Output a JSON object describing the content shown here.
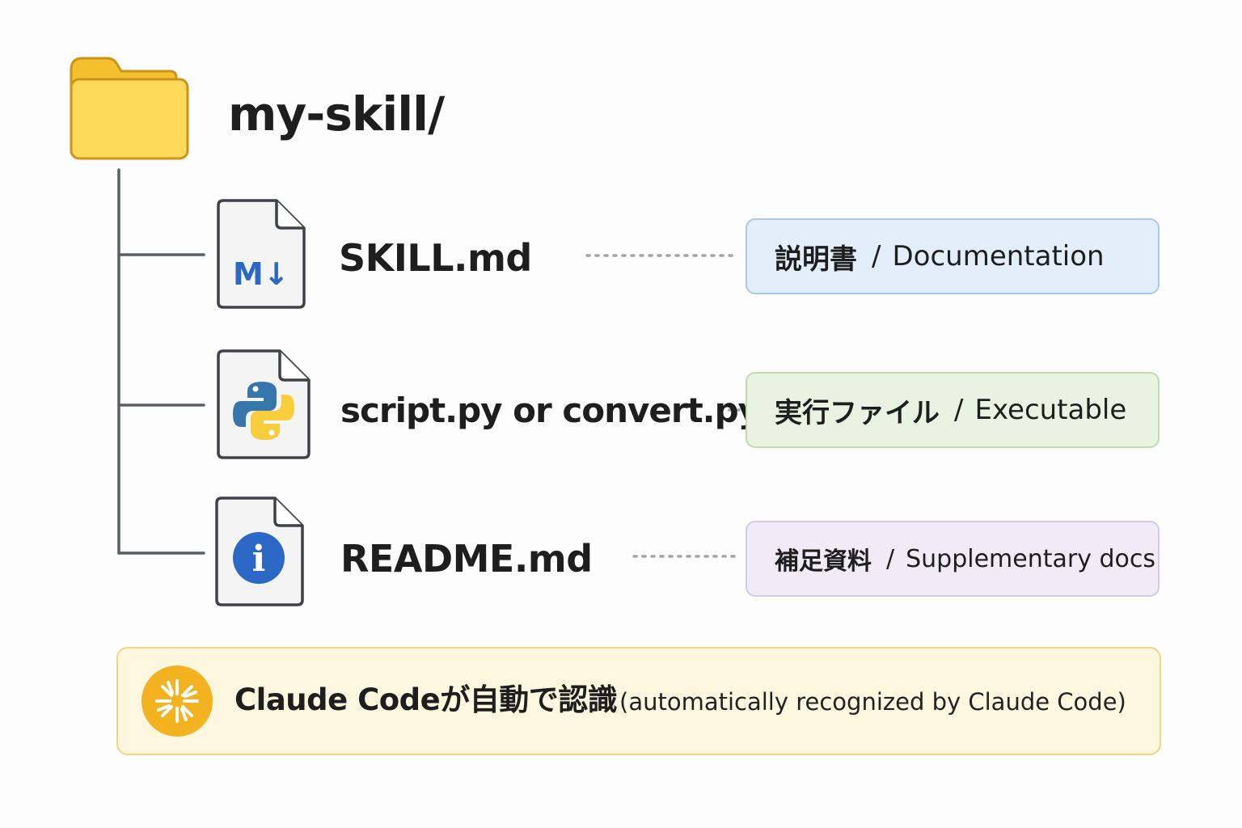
{
  "folder": {
    "name": "my-skill/",
    "icon": "folder-icon",
    "color": "#f7c93e"
  },
  "files": [
    {
      "name": "SKILL.md",
      "icon": "markdown-icon",
      "icon_text": "M↓",
      "description_jp": "説明書",
      "description_en": "Documentation"
    },
    {
      "name": "script.py or convert.py",
      "icon": "python-icon",
      "description_jp": "実行ファイル",
      "description_en": "Executable"
    },
    {
      "name": "README.md",
      "icon": "info-icon",
      "icon_text": "i",
      "description_jp": "補足資料",
      "description_en": "Supplementary docs"
    }
  ],
  "separator": "/",
  "callout": {
    "icon": "claude-sparkle-icon",
    "main": "Claude Codeが自動で認識",
    "sub": "(automatically recognized by Claude Code)"
  },
  "colors": {
    "doc_box": "#e3eefb",
    "exe_box": "#e8f3e2",
    "sup_box": "#efecf8",
    "callout_box": "#fdf7e0",
    "accent_blue": "#2b67c5",
    "claude_orange": "#f3b320"
  }
}
